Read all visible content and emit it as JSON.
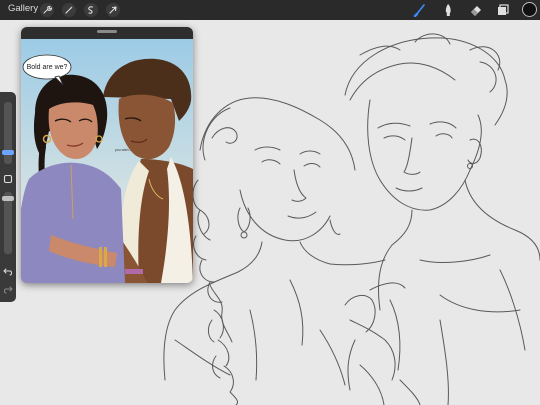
{
  "toolbar": {
    "gallery_label": "Gallery",
    "left_icons": [
      "wrench-icon",
      "magic-wand-icon",
      "selection-icon",
      "transform-arrow-icon"
    ],
    "right_icons": [
      "brush-icon",
      "smudge-icon",
      "eraser-icon",
      "layers-icon",
      "color-swatch"
    ],
    "active_tool": "brush-icon",
    "accent_color": "#3d8bff",
    "current_color": "#111111"
  },
  "sidebar": {
    "icons": [
      "brush-size-slider",
      "modify-square-icon",
      "opacity-slider",
      "undo-icon",
      "redo-icon"
    ]
  },
  "reference": {
    "speech_bubble_text": "Bold are we?",
    "small_text": "you wish..."
  }
}
